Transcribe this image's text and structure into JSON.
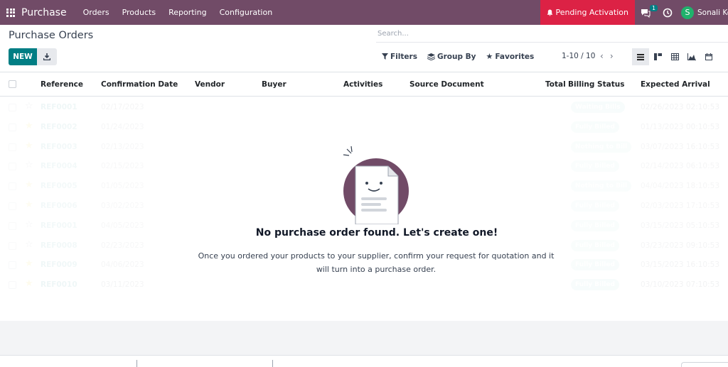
{
  "navbar": {
    "app_name": "Purchase",
    "menu": [
      "Orders",
      "Products",
      "Reporting",
      "Configuration"
    ],
    "pending_label": "Pending Activation",
    "chat_count": "1",
    "user_initial": "S",
    "user_name": "Sonali Ko",
    "colors": {
      "brand": "#714b67",
      "pending": "#dc2245",
      "avatar": "#20b26c"
    }
  },
  "control_panel": {
    "title": "Purchase Orders",
    "search_placeholder": "Search...",
    "new_label": "NEW",
    "filters_label": "Filters",
    "groupby_label": "Group By",
    "favorites_label": "Favorites",
    "pager": "1-10 / 10"
  },
  "table": {
    "headers": [
      "Reference",
      "Confirmation Date",
      "Vendor",
      "Buyer",
      "Activities",
      "Source Document",
      "Total",
      "Billing Status",
      "Expected Arrival"
    ],
    "rows": [
      {
        "ref": "REF0001",
        "date": "02/17/2023",
        "starred": false,
        "billing": "Waiting Bills",
        "arrival": "02/26/2023 02:10:53"
      },
      {
        "ref": "REF0002",
        "date": "01/24/2023",
        "starred": true,
        "billing": "Fully Billed",
        "arrival": "01/13/2023 00:10:53"
      },
      {
        "ref": "REF0003",
        "date": "02/13/2023",
        "starred": true,
        "billing": "Nothing to Bill",
        "arrival": "03/07/2023 16:10:53"
      },
      {
        "ref": "REF0004",
        "date": "02/15/2023",
        "starred": false,
        "billing": "Fully Billed",
        "arrival": "02/14/2023 06:10:53"
      },
      {
        "ref": "REF0005",
        "date": "01/05/2023",
        "starred": true,
        "billing": "Nothing to Bill",
        "arrival": "04/04/2023 18:10:53"
      },
      {
        "ref": "REF0006",
        "date": "03/02/2023",
        "starred": true,
        "billing": "Fully Billed",
        "arrival": "02/03/2023 17:10:53"
      },
      {
        "ref": "REF0001",
        "date": "04/05/2023",
        "starred": false,
        "billing": "Fully Billed",
        "arrival": "03/15/2023 05:10:53"
      },
      {
        "ref": "REF0008",
        "date": "02/23/2023",
        "starred": false,
        "billing": "Fully Billed",
        "arrival": "03/23/2023 09:10:53"
      },
      {
        "ref": "REF0009",
        "date": "04/06/2023",
        "starred": true,
        "billing": "Fully Billed",
        "arrival": "03/15/2023 16:10:53"
      },
      {
        "ref": "REF0010",
        "date": "03/11/2023",
        "starred": true,
        "billing": "Fully Billed",
        "arrival": "03/10/2023 07:10:53"
      }
    ]
  },
  "empty_state": {
    "title": "No purchase order found. Let's create one!",
    "text": "Once you ordered your products to your supplier, confirm your request for quotation and it will turn into a purchase order."
  }
}
